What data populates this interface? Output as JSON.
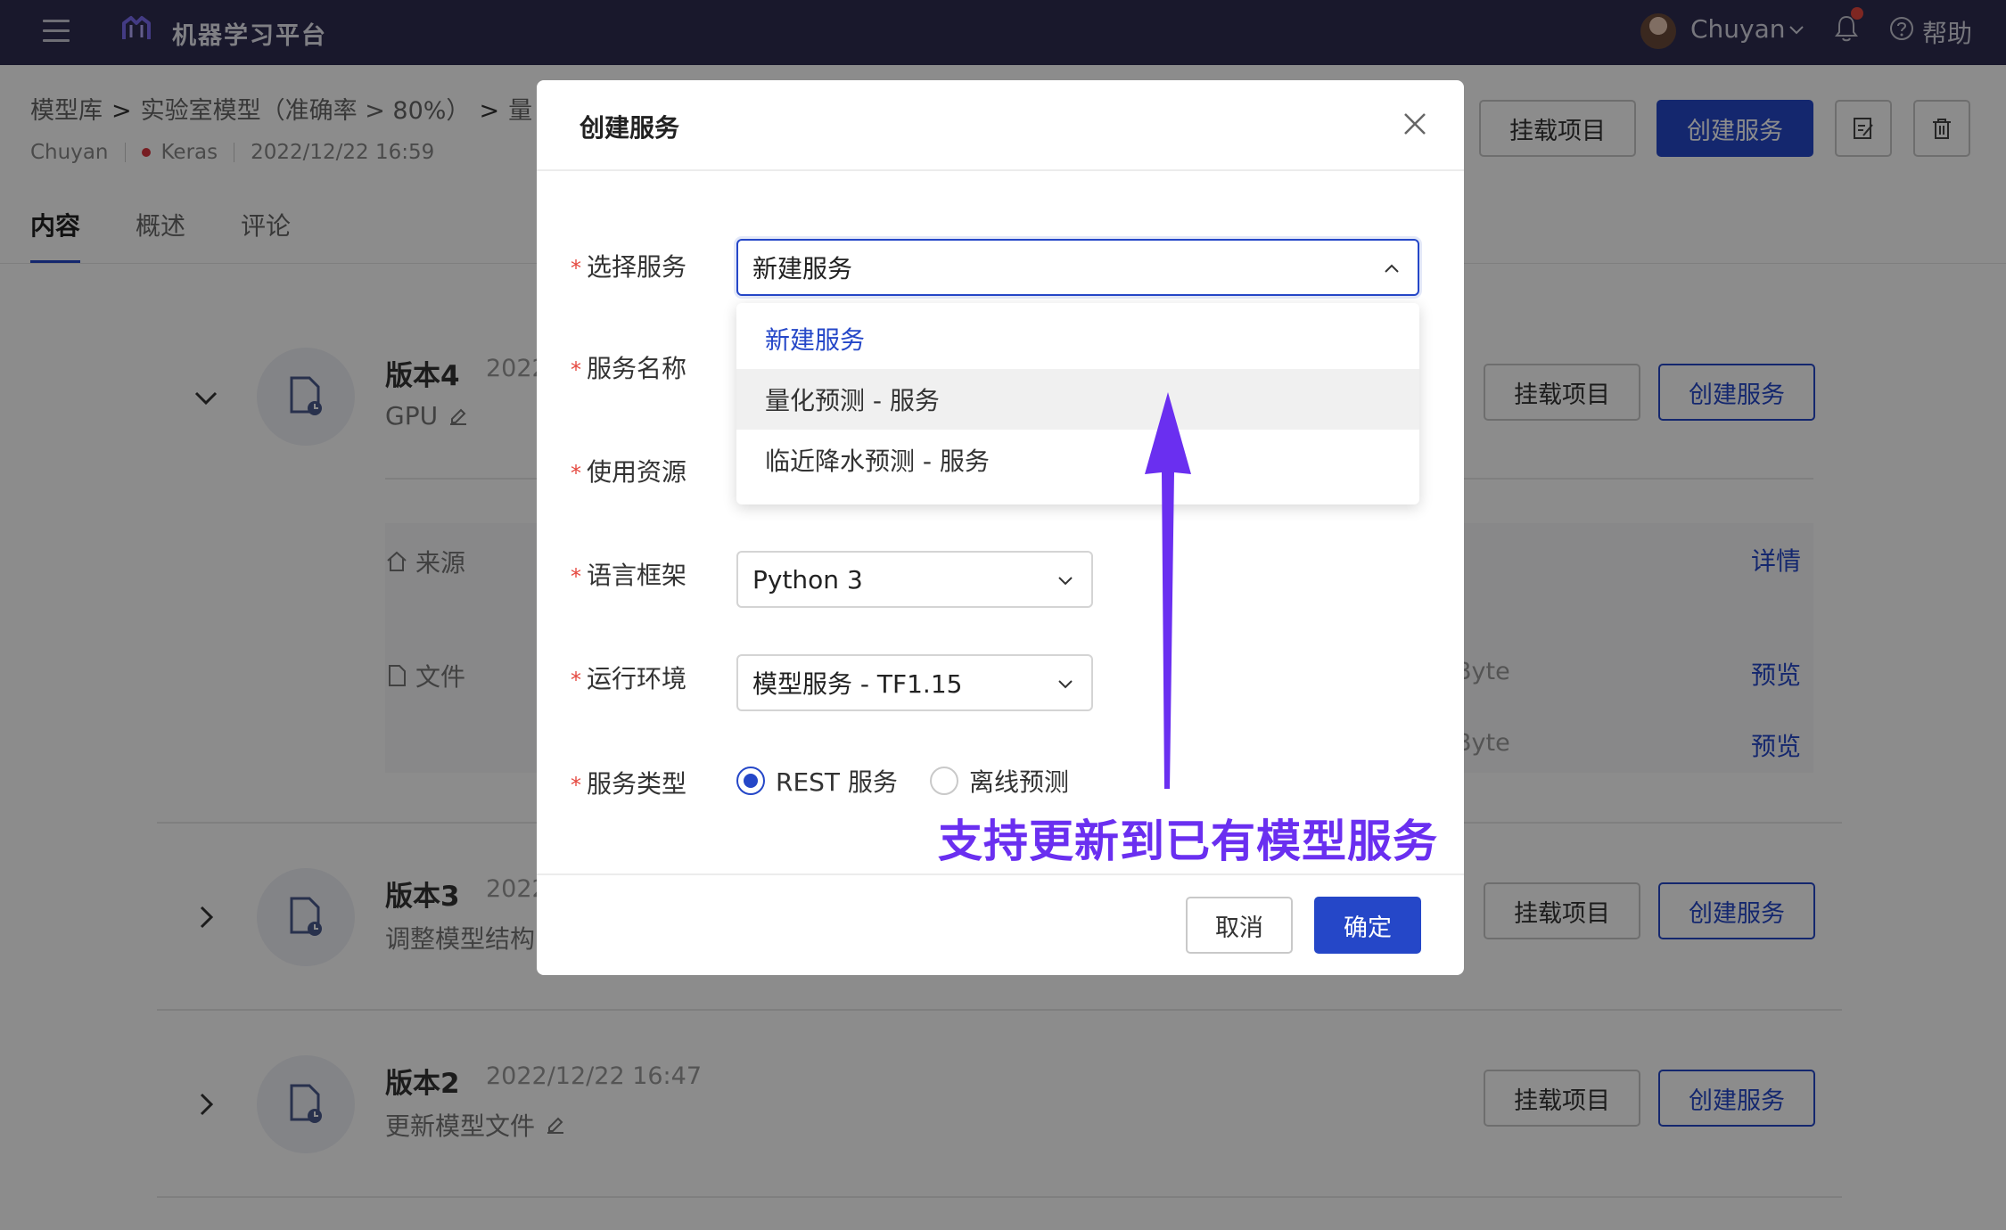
{
  "topbar": {
    "app_title": "机器学习平台",
    "username": "Chuyan",
    "help_label": "帮助"
  },
  "header": {
    "breadcrumb": [
      "模型库",
      "实验室模型（准确率 > 80%）",
      "量"
    ],
    "breadcrumb_sep": ">",
    "author": "Chuyan",
    "framework": "Keras",
    "timestamp": "2022/12/22 16:59",
    "mount_label": "挂载项目",
    "create_service_label": "创建服务"
  },
  "tabs": [
    {
      "label": "内容",
      "active": true
    },
    {
      "label": "概述",
      "active": false
    },
    {
      "label": "评论",
      "active": false
    }
  ],
  "versions": [
    {
      "title": "版本4",
      "date": "2022",
      "desc": "GPU",
      "expanded": true
    },
    {
      "title": "版本3",
      "date": "2022",
      "desc": "调整模型结构",
      "expanded": false
    },
    {
      "title": "版本2",
      "date": "2022/12/22 16:47",
      "desc": "更新模型文件",
      "expanded": false
    }
  ],
  "version_actions": {
    "mount_label": "挂载项目",
    "create_service_label": "创建服务"
  },
  "details": {
    "source_label": "来源",
    "files_label": "文件",
    "detail_link": "详情",
    "preview_link": "预览",
    "size_fragment": "Byte"
  },
  "modal": {
    "title": "创建服务",
    "fields": {
      "select_service": "选择服务",
      "service_name": "服务名称",
      "resource": "使用资源",
      "language": "语言框架",
      "runtime": "运行环境",
      "service_type": "服务类型"
    },
    "select_service_value": "新建服务",
    "dropdown_options": [
      {
        "label": "新建服务",
        "selected": true
      },
      {
        "label": "量化预测 - 服务",
        "hover": true
      },
      {
        "label": "临近降水预测 - 服务"
      }
    ],
    "language_value": "Python 3",
    "runtime_value": "模型服务 - TF1.15",
    "service_types": [
      {
        "label": "REST 服务",
        "checked": true
      },
      {
        "label": "离线预测",
        "checked": false
      }
    ],
    "cancel_label": "取消",
    "confirm_label": "确定"
  },
  "annotation_text": "支持更新到已有模型服务",
  "colors": {
    "topbar_bg": "#2f2d51",
    "primary": "#2547c8",
    "annotation": "#6a2ff0",
    "required": "#e5483f"
  }
}
